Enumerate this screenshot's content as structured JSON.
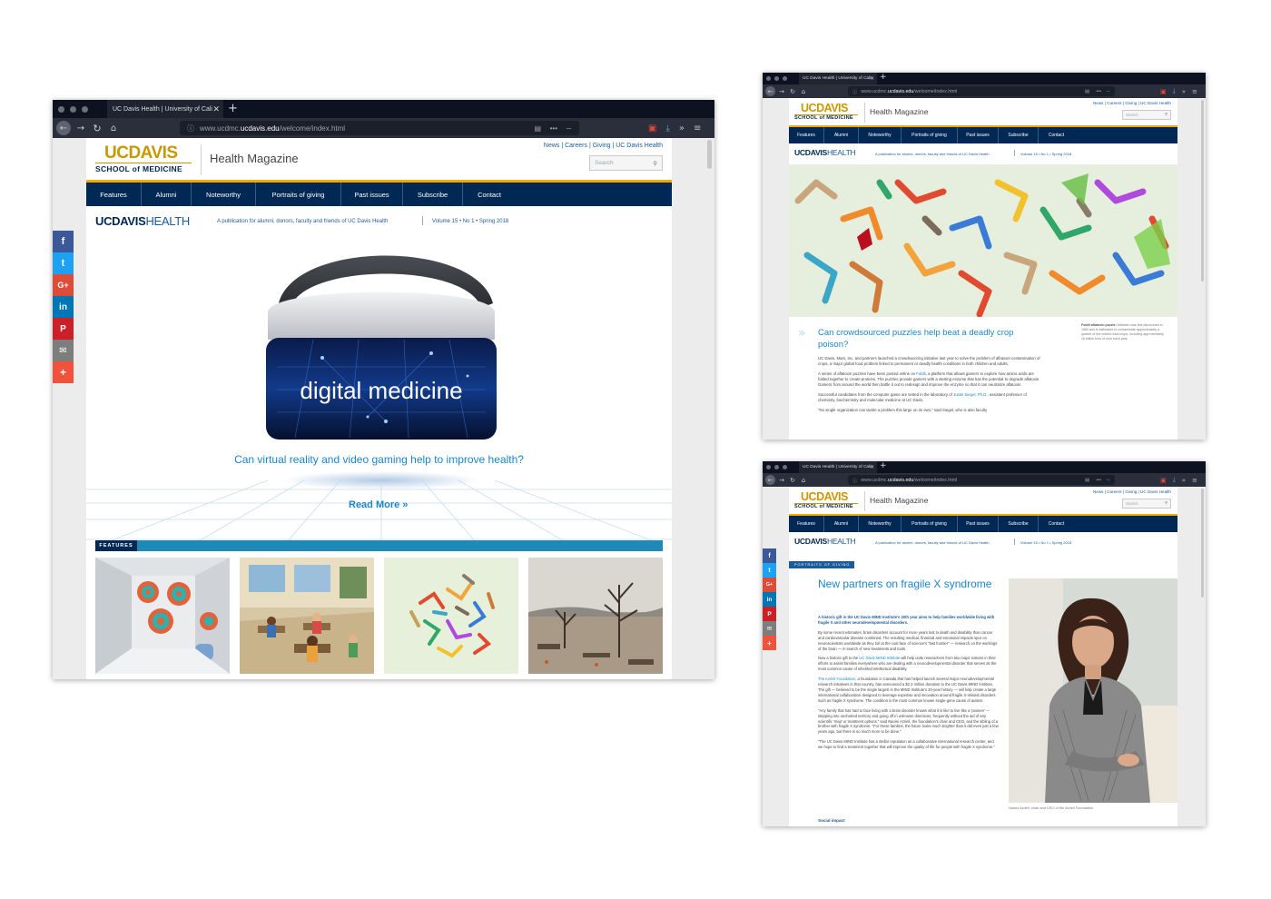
{
  "browser": {
    "tab_title": "UC Davis Health | University of Cali",
    "tab_close": "✕",
    "new_tab": "+",
    "url_prefix": "www.ucdmc.",
    "url_host": "ucdavis.edu",
    "url_path": "/welcome/index.html",
    "badge_count": "2"
  },
  "site": {
    "logo_uc": "UC",
    "logo_davis": "DAVIS",
    "logo_school": "SCHOOL of MEDICINE",
    "magazine_title": "Health Magazine",
    "top_links": "News | Careers | Giving | UC Davis Health",
    "search_placeholder": "Search",
    "nav": [
      "Features",
      "Alumni",
      "Noteworthy",
      "Portraits of giving",
      "Past issues",
      "Subscribe",
      "Contact"
    ],
    "ucdh_bold": "UCDAVIS",
    "ucdh_light": "HEALTH",
    "tagline": "A publication for alumni, donors, faculty and friends of UC Davis Health",
    "issue": "Volume 15 • No 1 • Spring 2018"
  },
  "share": [
    {
      "label": "f",
      "color": "#3b5998",
      "icon": "facebook-icon"
    },
    {
      "label": "t",
      "color": "#1da1f2",
      "icon": "twitter-icon"
    },
    {
      "label": "G+",
      "color": "#dd4b39",
      "icon": "google-plus-icon"
    },
    {
      "label": "in",
      "color": "#0077b5",
      "icon": "linkedin-icon"
    },
    {
      "label": "P",
      "color": "#cb2027",
      "icon": "pinterest-icon"
    },
    {
      "label": "✉",
      "color": "#7d7d7d",
      "icon": "email-icon"
    },
    {
      "label": "+",
      "color": "#f0523b",
      "icon": "more-share-icon"
    }
  ],
  "home": {
    "hero_text": "digital medicine",
    "hero_question": "Can virtual reality and video gaming help to improve health?",
    "read_more": "Read More »",
    "features_label": "FEATURES"
  },
  "article1": {
    "title": "Can crowdsourced puzzles help beat a deadly crop poison?",
    "caption_bold": "Foldit aflatoxin puzzle:",
    "caption": "Aflatoxin was first discovered in 1960 and is estimated to contaminate approximately a quarter of the world's food crops, including approximately 16 billion tons of corn each year.",
    "p1": "UC Davis, Mars, Inc. and partners launched a crowdsourcing initiative last year to solve the problem of aflatoxin contamination of crops, a major global food problem linked to permanent or deadly health conditions in both children and adults.",
    "p2a": "A series of aflatoxin puzzles have been posted online on ",
    "p2link": "Foldit",
    "p2b": ", a platform that allows gamers to explore how amino acids are folded together to create proteins. The puzzles provide gamers with a starting enzyme that has the potential to degrade aflatoxin. Gamers from around the world then battle it out to redesign and improve the enzyme so that it can neutralize aflatoxin.",
    "p3a": "Successful candidates from the computer game are tested in the laboratory of ",
    "p3link": "Justin Siegel, Ph.D.",
    "p3b": ", assistant professor of chemistry, biochemistry and molecular medicine at UC Davis.",
    "p4": "\"No single organization can tackle a problem this large on its own,\" said Siegel, who is also faculty"
  },
  "article2": {
    "section_label": "PORTRAITS OF GIVING",
    "title": "New partners on fragile X syndrome",
    "lede": "A historic gift in the UC Davis MIND Institute's 20th year aims to help families worldwide living with fragile X and other neurodevelopmental disorders.",
    "p1": "By some recent estimates, brain disorders account for more years lost to death and disability than cancer and cardiovascular disease combined. The resulting medical, financial and emotional impacts spur on neuroscientists worldwide as they toil at the coal face of science's \"last frontier\" — research on the workings of the brain — in search of new treatments and tools.",
    "p2a": "Now a historic gift to the ",
    "p2link": "UC Davis MIND Institute",
    "p2b": " will help unite researchers from two major nations in their efforts to assist families everywhere who are dealing with a neurodevelopmental disorder that serves as the most common cause of inherited intellectual disability.",
    "p3link": "The Azrieli Foundation",
    "p3b": ", a foundation in Canada that has helped launch several major neurodevelopmental research initiatives in that country, has announced a $2.3 million donation to the UC Davis MIND Institute. The gift — believed to be the single largest in the MIND Institute's 20-year history — will help create a large international collaboration designed to leverage expertise and innovation around fragile X-related disorders such as fragile X syndrome. The condition is the most common known single-gene cause of autism.",
    "p4": "\"Any family that has had to face living with a brain disorder knows what it is like to live like a 'pioneer' — stepping into uncharted territory and going off in unknown directions, frequently without the aid of any scientific 'map' or treatment options,\" said Naomi Azrieli, the foundation's chair and CEO, and the sibling of a brother with fragile X syndrome. \"For these families, the future looks much brighter than it did even just a few years ago, but there is so much more to be done.\"",
    "p5": "\"The UC Davis MIND Institute has a stellar reputation as a collaborative international research center, and we hope to find a treatment together that will improve the quality of life for people with fragile X syndrome.\"",
    "subhead": "Social impact",
    "photo_caption": "Naomi Azrieli, chair and CEO of the Azrieli Foundation"
  },
  "colors": {
    "navy": "#002855",
    "gold": "#c99700",
    "accent_blue": "#1a86c8",
    "browser_dark": "#0c1220"
  }
}
